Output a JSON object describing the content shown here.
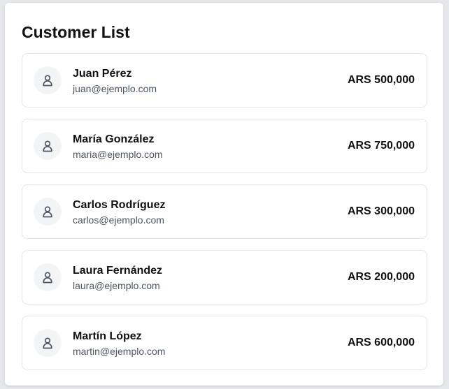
{
  "page": {
    "title": "Customer List"
  },
  "customers": [
    {
      "name": "Juan Pérez",
      "email": "juan@ejemplo.com",
      "amount": "ARS 500,000"
    },
    {
      "name": "María González",
      "email": "maria@ejemplo.com",
      "amount": "ARS 750,000"
    },
    {
      "name": "Carlos Rodríguez",
      "email": "carlos@ejemplo.com",
      "amount": "ARS 300,000"
    },
    {
      "name": "Laura Fernández",
      "email": "laura@ejemplo.com",
      "amount": "ARS 200,000"
    },
    {
      "name": "Martín López",
      "email": "martin@ejemplo.com",
      "amount": "ARS 600,000"
    }
  ],
  "icons": {
    "avatar": "user-icon"
  },
  "colors": {
    "avatar_background": "#f3f4f6",
    "icon_stroke": "#4b5563",
    "card_border": "#e2e5ea"
  }
}
